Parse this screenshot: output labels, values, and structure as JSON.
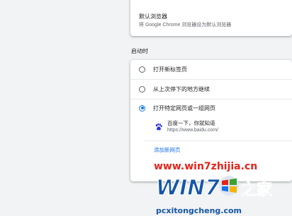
{
  "default_browser": {
    "title": "默认浏览器",
    "description": "将 Google Chrome 浏览器设为默认浏览器"
  },
  "startup": {
    "section_label": "启动时",
    "options": [
      {
        "label": "打开新标签页",
        "checked": false
      },
      {
        "label": "从上次停下的地方继续",
        "checked": false
      },
      {
        "label": "打开特定网页或一组网页",
        "checked": true
      }
    ],
    "pages": [
      {
        "name": "百度一下，你就知道",
        "url": "https://www.baidu.com/",
        "icon": "baidu-paw-icon"
      }
    ],
    "add_page_label": "添加新网页"
  },
  "watermark": {
    "url": "www.win7zhijia.cn",
    "logo_text": "WIN7",
    "logo_text_2": "之家",
    "subtext": "pcxitongcheng.com"
  },
  "colors": {
    "accent": "#1a73e8",
    "background": "#f1f3f4",
    "watermark_red": "#e5241a",
    "watermark_blue": "#1556a8"
  }
}
